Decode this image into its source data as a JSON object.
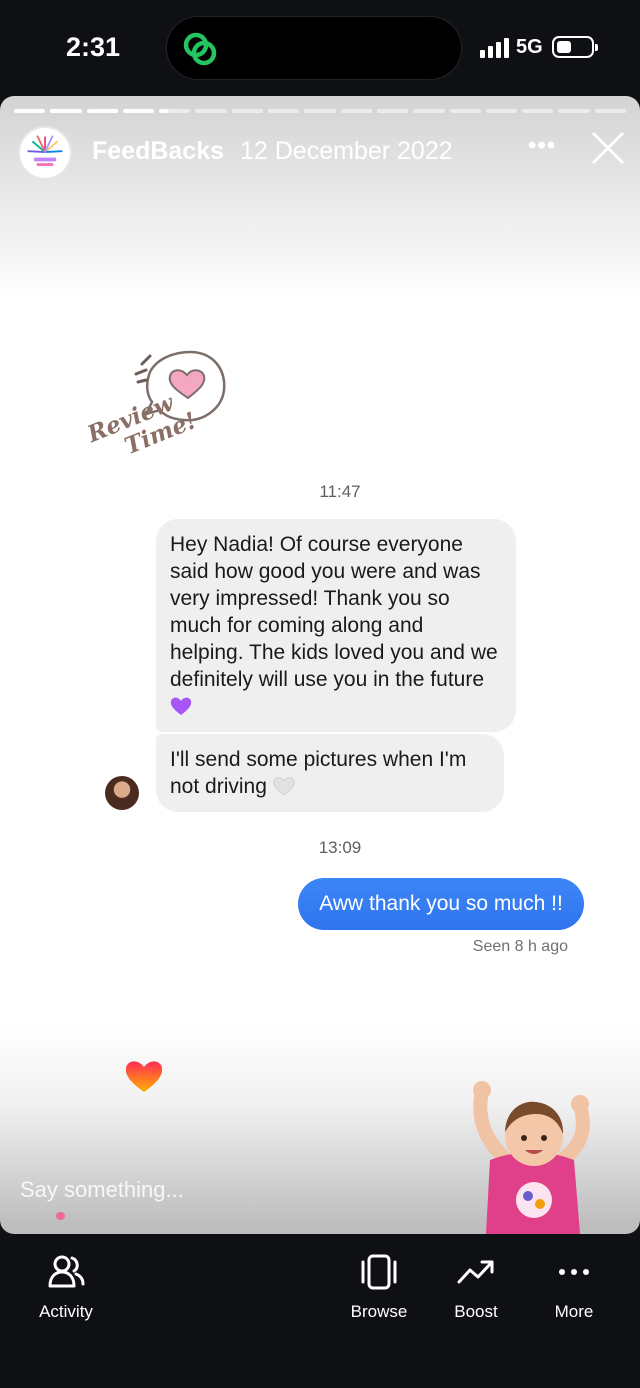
{
  "status_bar": {
    "time": "2:31",
    "network": "5G"
  },
  "story": {
    "account_name": "FeedBacks",
    "date": "12 December 2022",
    "reply_placeholder": "Say something...",
    "progress_segments": 17,
    "progress_completed": 4
  },
  "sticker": {
    "line1": "Review",
    "line2": "Time!"
  },
  "chat": {
    "timestamp_1": "11:47",
    "message_1": "Hey Nadia! Of course everyone said how good you were and was very impressed! Thank you so much for coming along and helping. The kids loved you and we definitely will use you in the future",
    "message_2": "I'll send some pictures when I'm not driving",
    "timestamp_2": "13:09",
    "reply": "Aww thank you so much !!",
    "seen": "Seen 8 h ago"
  },
  "bottom_nav": [
    {
      "label": "Activity",
      "icon": "activity-icon"
    },
    {
      "label": "Browse",
      "icon": "browse-icon"
    },
    {
      "label": "Boost",
      "icon": "boost-icon"
    },
    {
      "label": "More",
      "icon": "more-icon"
    }
  ],
  "colors": {
    "sent_bubble": "#3b82f6",
    "received_bubble": "#efefef",
    "island_icon": "#22c55e"
  }
}
